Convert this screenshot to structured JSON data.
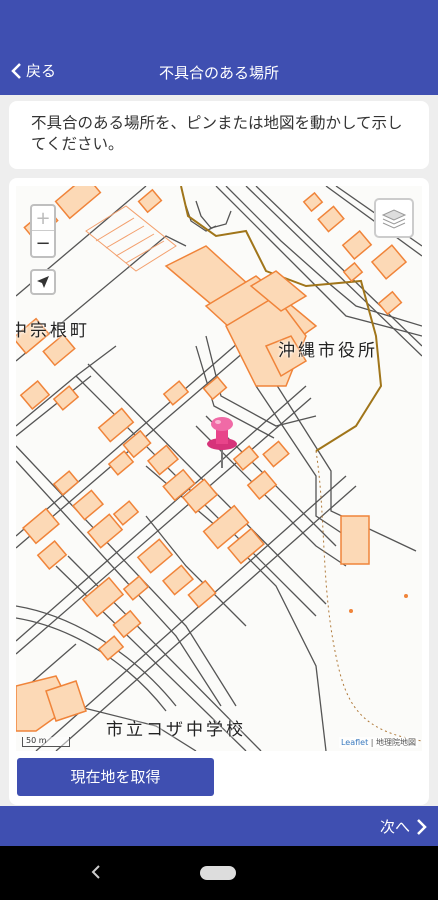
{
  "header": {
    "back_label": "戻る",
    "title": "不具合のある場所"
  },
  "instruction": "不具合のある場所を、ピンまたは地図を動かして示してください。",
  "map": {
    "zoom_in": "+",
    "zoom_out": "−",
    "labels": {
      "town": "中宗根町",
      "city_hall": "沖縄市役所",
      "school": "市立コザ中学校"
    },
    "scale": "50 m",
    "attribution_leaflet": "Leaflet",
    "attribution_sep": " | ",
    "attribution_gsi": "地理院地図",
    "building_color": "#fcd9b6",
    "building_border": "#f0843a",
    "road_color": "#555555",
    "pin_color": "#e8448a"
  },
  "get_location_button": "現在地を取得",
  "footer": {
    "next_label": "次へ"
  },
  "theme": {
    "primary": "#3f4fb1"
  }
}
